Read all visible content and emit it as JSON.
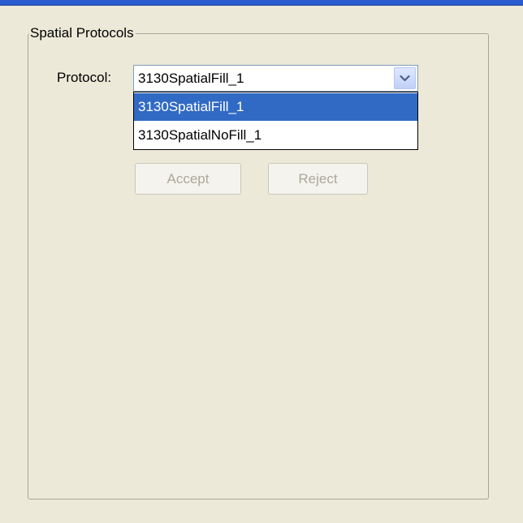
{
  "group": {
    "title": "Spatial Protocols"
  },
  "protocol": {
    "label": "Protocol:",
    "selected_value": "3130SpatialFill_1",
    "options": [
      {
        "label": "3130SpatialFill_1",
        "highlighted": true
      },
      {
        "label": "3130SpatialNoFill_1",
        "highlighted": false
      }
    ]
  },
  "buttons": {
    "accept": {
      "label": "Accept",
      "enabled": false
    },
    "reject": {
      "label": "Reject",
      "enabled": false
    }
  },
  "icons": {
    "combo_arrow": "chevron-down-icon"
  },
  "colors": {
    "background": "#ece9d8",
    "selection": "#316ac5",
    "disabled_text": "#aca899",
    "title_bar": "#2a5ccf"
  }
}
